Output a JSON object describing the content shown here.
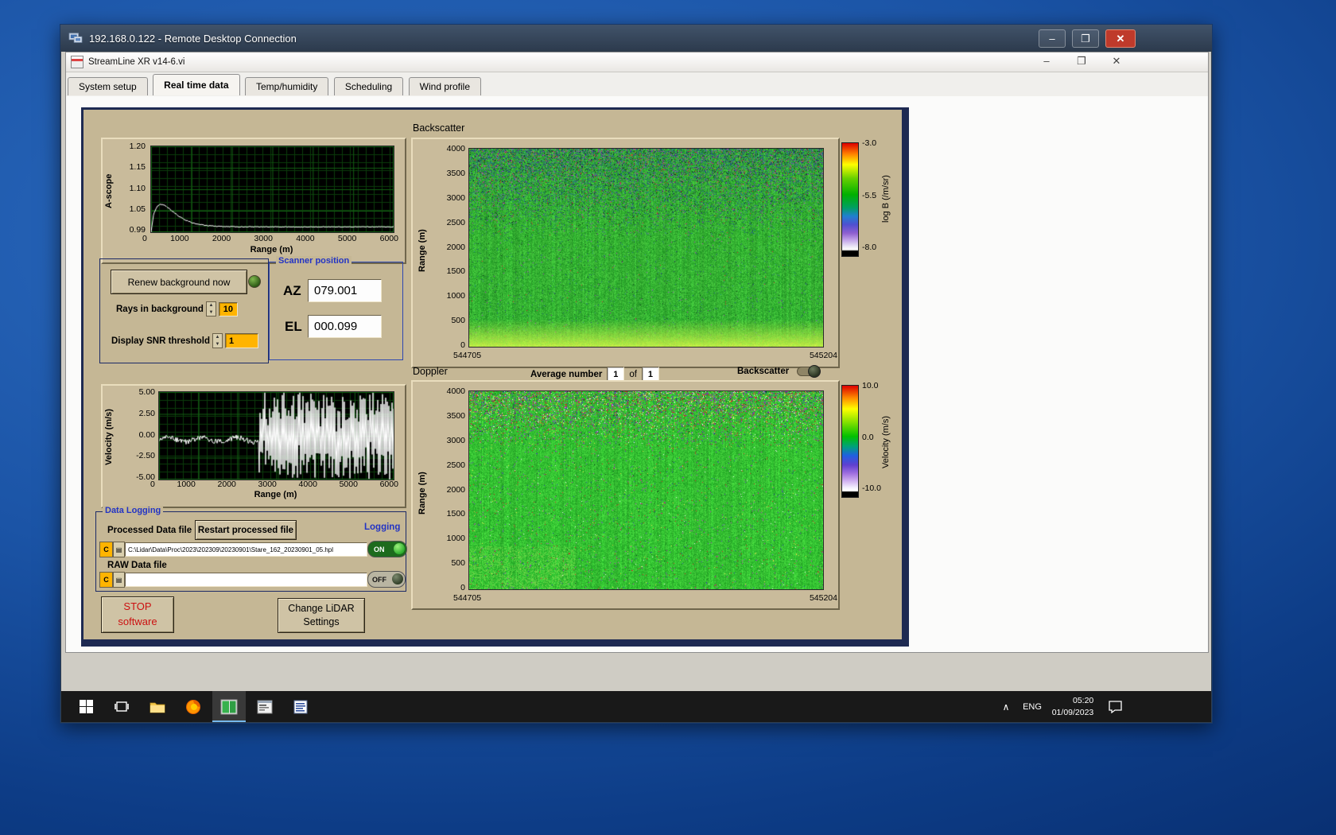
{
  "rdp": {
    "title": "192.168.0.122 - Remote Desktop Connection",
    "buttons": {
      "minimize": "–",
      "maximize": "❐",
      "close": "✕"
    }
  },
  "app": {
    "title": "StreamLine XR v14-6.vi",
    "buttons": {
      "minimize": "–",
      "restore": "❐",
      "close": "✕"
    },
    "tabs": [
      {
        "label": "System setup"
      },
      {
        "label": "Real time data"
      },
      {
        "label": "Temp/humidity"
      },
      {
        "label": "Scheduling"
      },
      {
        "label": "Wind profile"
      }
    ]
  },
  "controls": {
    "renew_button": "Renew background now",
    "rays_label": "Rays in background",
    "rays_value": "10",
    "snr_label": "Display SNR threshold",
    "snr_value": "1",
    "scanner": {
      "title": "Scanner position",
      "az_label": "AZ",
      "az_value": "079.001",
      "el_label": "EL",
      "el_value": "000.099"
    },
    "average": {
      "label": "Average number",
      "value": "1",
      "of": "of",
      "total": "1",
      "backscatter_toggle_label": "Backscatter"
    }
  },
  "logging": {
    "group_title": "Data Logging",
    "processed_label": "Processed Data file",
    "restart_button": "Restart processed file",
    "logging_label": "Logging",
    "processed_drive": "C",
    "processed_path": "C:\\Lidar\\Data\\Proc\\2023\\202309\\20230901\\Stare_162_20230901_05.hpl",
    "processed_state": "ON",
    "raw_label": "RAW Data file",
    "raw_drive": "C",
    "raw_path": "",
    "raw_state": "OFF"
  },
  "actions": {
    "stop_line1": "STOP",
    "stop_line2": "software",
    "change_line1": "Change LiDAR",
    "change_line2": "Settings"
  },
  "taskbar": {
    "caret": "∧",
    "lang": "ENG",
    "time": "05:20",
    "date": "01/09/2023"
  },
  "colors": {
    "panel_tan": "#c5b795",
    "navy_frame": "#1e2a52",
    "group_title_blue": "#2334c4",
    "stop_red": "#cc1111",
    "value_orange": "#ffb400",
    "led_green": "#4a8a2a",
    "toggle_on_green": "#1d6b1d"
  },
  "chart_data": [
    {
      "id": "ascope",
      "type": "line",
      "xlabel": "Range (m)",
      "ylabel": "A-scope",
      "xlim": [
        0,
        6000
      ],
      "ylim": [
        0.99,
        1.2
      ],
      "xticks": [
        "0",
        "1000",
        "2000",
        "3000",
        "4000",
        "5000",
        "6000"
      ],
      "yticks": [
        "1.20",
        "1.15",
        "1.10",
        "1.05",
        "0.99"
      ],
      "line_color": "#ffffff",
      "grid": true,
      "pattern": "trace rises from ~0.99 at 0 m to a peak of ~1.06 near 250 m, then decays to a flat ~1.00 out to 6000 m"
    },
    {
      "id": "backscatter",
      "type": "heatmap",
      "title": "Backscatter",
      "ylabel": "Range (m)",
      "yticks": [
        "4000",
        "3500",
        "3000",
        "2500",
        "2000",
        "1500",
        "1000",
        "500",
        "0"
      ],
      "x_start_label": "544705",
      "x_end_label": "545204",
      "colorbar": {
        "label": "log B (/m/sr)",
        "ticks": [
          "-3.0",
          "-5.5",
          "-8.0"
        ]
      },
      "pattern": "uniform mid-green field (~ -5.5) with dense dark speckle noise above ~3000 m and a bright yellow-green layer below ~300 m"
    },
    {
      "id": "velocity",
      "type": "line",
      "xlabel": "Range (m)",
      "ylabel": "Velocity (m/s)",
      "xlim": [
        0,
        6000
      ],
      "ylim": [
        -5,
        5
      ],
      "xticks": [
        "0",
        "1000",
        "2000",
        "3000",
        "4000",
        "5000",
        "6000"
      ],
      "yticks": [
        "5.00",
        "2.50",
        "0.00",
        "-2.50",
        "-5.00"
      ],
      "line_color": "#ffffff",
      "grid": true,
      "pattern": "velocity near -0.5 m/s with small fluctuations out to ~2600 m, then saturated full-scale ±5 m/s spikes to 6000 m"
    },
    {
      "id": "doppler",
      "type": "heatmap",
      "title": "Doppler",
      "ylabel": "Range (m)",
      "yticks": [
        "4000",
        "3500",
        "3000",
        "2500",
        "2000",
        "1500",
        "1000",
        "500",
        "0"
      ],
      "x_start_label": "544705",
      "x_end_label": "545204",
      "colorbar": {
        "label": "Velocity (m/s)",
        "ticks": [
          "10.0",
          "0.0",
          "-10.0"
        ]
      },
      "pattern": "near-zero (green) velocity field with multicoloured speckle noise concentrated above ~3000 m"
    }
  ]
}
